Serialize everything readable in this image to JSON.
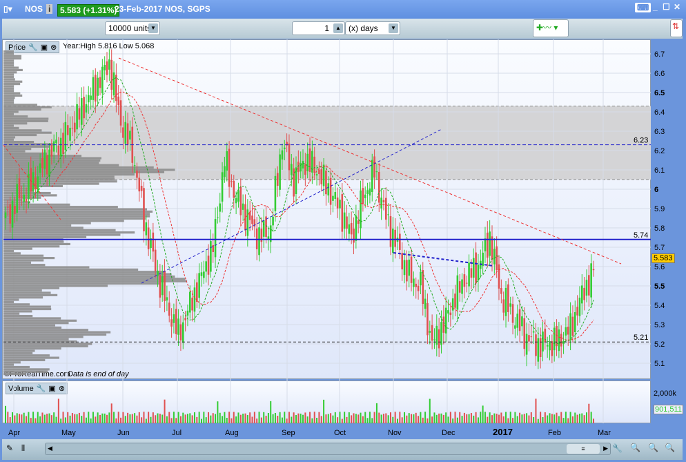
{
  "window": {
    "symbol": "NOS",
    "price_badge": "5.583 (+1.31%)",
    "info": "23-Feb-2017 NOS, SGPS"
  },
  "toolbar": {
    "units": "10000 units",
    "period_value": "1",
    "period_unit": "(x) days"
  },
  "price_panel": {
    "label": "Price",
    "info": "Year:High 5.816 Low 5.068",
    "credit": "©ProRealTime.com",
    "credit_note": "Data is end of day",
    "y_ticks": [
      "6.7",
      "6.6",
      "6.5",
      "6.4",
      "6.3",
      "6.2",
      "6.1",
      "6",
      "5.9",
      "5.8",
      "5.7",
      "5.6",
      "5.5",
      "5.4",
      "5.3",
      "5.2",
      "5.1"
    ],
    "levels": [
      {
        "label": "6.23",
        "value": 6.23
      },
      {
        "label": "5.74",
        "value": 5.74
      },
      {
        "label": "5.21",
        "value": 5.21
      }
    ],
    "last_price": "5.583"
  },
  "volume_panel": {
    "label": "Volume",
    "y_tick": "2,000k",
    "last_volume": "901,511"
  },
  "x_axis": [
    "Apr",
    "May",
    "Jun",
    "Jul",
    "Aug",
    "Sep",
    "Oct",
    "Nov",
    "Dec",
    "2017",
    "Feb",
    "Mar"
  ],
  "colors": {
    "up": "#33cc33",
    "down": "#e05050",
    "badge": "#1e9a1e",
    "last": "#ffcc00"
  },
  "chart_data": {
    "type": "candlestick",
    "ylim": [
      5.05,
      6.75
    ],
    "closes": [
      5.85,
      5.95,
      6.0,
      6.1,
      6.2,
      6.25,
      6.35,
      6.45,
      6.55,
      6.65,
      6.35,
      6.2,
      5.85,
      5.6,
      5.4,
      5.25,
      5.4,
      5.55,
      5.7,
      6.15,
      5.95,
      5.85,
      5.75,
      5.8,
      6.25,
      6.05,
      6.15,
      6.1,
      6.0,
      5.9,
      5.75,
      5.95,
      6.1,
      5.85,
      5.7,
      5.55,
      5.5,
      5.2,
      5.3,
      5.45,
      5.55,
      5.6,
      5.75,
      5.45,
      5.35,
      5.25,
      5.2,
      5.2,
      5.22,
      5.28,
      5.45,
      5.58
    ]
  }
}
